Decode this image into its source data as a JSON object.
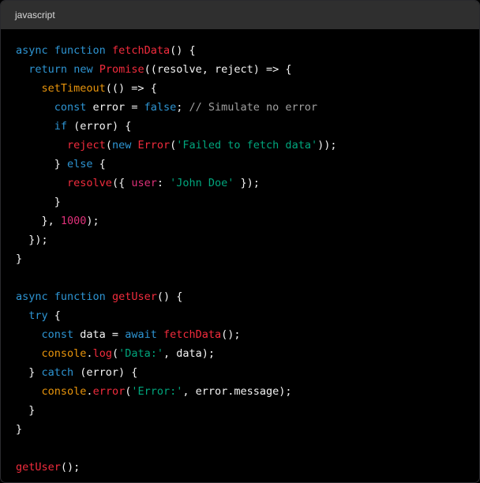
{
  "header": {
    "language": "javascript"
  },
  "colors": {
    "background": "#000000",
    "header": "#2f2f2f",
    "keyword": "#2e95d3",
    "function": "#f22c3d",
    "string": "#00a67d",
    "number": "#df3079",
    "comment": "#a0a0a0",
    "plain": "#f4f4f4",
    "builtin": "#e9950c"
  },
  "code": {
    "lines": [
      [
        [
          "kw",
          "async"
        ],
        [
          "plain",
          " "
        ],
        [
          "kw",
          "function"
        ],
        [
          "plain",
          " "
        ],
        [
          "fn",
          "fetchData"
        ],
        [
          "plain",
          "() {"
        ]
      ],
      [
        [
          "plain",
          "  "
        ],
        [
          "kw",
          "return"
        ],
        [
          "plain",
          " "
        ],
        [
          "kw",
          "new"
        ],
        [
          "plain",
          " "
        ],
        [
          "cls",
          "Promise"
        ],
        [
          "plain",
          "((resolve, reject) => {"
        ]
      ],
      [
        [
          "plain",
          "    "
        ],
        [
          "orange",
          "setTimeout"
        ],
        [
          "plain",
          "(() => {"
        ]
      ],
      [
        [
          "plain",
          "      "
        ],
        [
          "kw",
          "const"
        ],
        [
          "plain",
          " error = "
        ],
        [
          "kw",
          "false"
        ],
        [
          "plain",
          "; "
        ],
        [
          "cm",
          "// Simulate no error"
        ]
      ],
      [
        [
          "plain",
          "      "
        ],
        [
          "kw",
          "if"
        ],
        [
          "plain",
          " (error) {"
        ]
      ],
      [
        [
          "plain",
          "        "
        ],
        [
          "fn",
          "reject"
        ],
        [
          "plain",
          "("
        ],
        [
          "kw",
          "new"
        ],
        [
          "plain",
          " "
        ],
        [
          "cls",
          "Error"
        ],
        [
          "plain",
          "("
        ],
        [
          "str",
          "'Failed to fetch data'"
        ],
        [
          "plain",
          "));"
        ]
      ],
      [
        [
          "plain",
          "      } "
        ],
        [
          "kw",
          "else"
        ],
        [
          "plain",
          " {"
        ]
      ],
      [
        [
          "plain",
          "        "
        ],
        [
          "fn",
          "resolve"
        ],
        [
          "plain",
          "({ "
        ],
        [
          "prop",
          "user"
        ],
        [
          "plain",
          ": "
        ],
        [
          "str",
          "'John Doe'"
        ],
        [
          "plain",
          " });"
        ]
      ],
      [
        [
          "plain",
          "      }"
        ]
      ],
      [
        [
          "plain",
          "    }, "
        ],
        [
          "num",
          "1000"
        ],
        [
          "plain",
          ");"
        ]
      ],
      [
        [
          "plain",
          "  });"
        ]
      ],
      [
        [
          "plain",
          "}"
        ]
      ],
      [
        [
          "plain",
          ""
        ]
      ],
      [
        [
          "kw",
          "async"
        ],
        [
          "plain",
          " "
        ],
        [
          "kw",
          "function"
        ],
        [
          "plain",
          " "
        ],
        [
          "fn",
          "getUser"
        ],
        [
          "plain",
          "() {"
        ]
      ],
      [
        [
          "plain",
          "  "
        ],
        [
          "kw",
          "try"
        ],
        [
          "plain",
          " {"
        ]
      ],
      [
        [
          "plain",
          "    "
        ],
        [
          "kw",
          "const"
        ],
        [
          "plain",
          " data = "
        ],
        [
          "kw",
          "await"
        ],
        [
          "plain",
          " "
        ],
        [
          "fn",
          "fetchData"
        ],
        [
          "plain",
          "();"
        ]
      ],
      [
        [
          "plain",
          "    "
        ],
        [
          "orange",
          "console"
        ],
        [
          "plain",
          "."
        ],
        [
          "fn",
          "log"
        ],
        [
          "plain",
          "("
        ],
        [
          "str",
          "'Data:'"
        ],
        [
          "plain",
          ", data);"
        ]
      ],
      [
        [
          "plain",
          "  } "
        ],
        [
          "kw",
          "catch"
        ],
        [
          "plain",
          " (error) {"
        ]
      ],
      [
        [
          "plain",
          "    "
        ],
        [
          "orange",
          "console"
        ],
        [
          "plain",
          "."
        ],
        [
          "fn",
          "error"
        ],
        [
          "plain",
          "("
        ],
        [
          "str",
          "'Error:'"
        ],
        [
          "plain",
          ", error.message);"
        ]
      ],
      [
        [
          "plain",
          "  }"
        ]
      ],
      [
        [
          "plain",
          "}"
        ]
      ],
      [
        [
          "plain",
          ""
        ]
      ],
      [
        [
          "fn",
          "getUser"
        ],
        [
          "plain",
          "();"
        ]
      ]
    ]
  }
}
